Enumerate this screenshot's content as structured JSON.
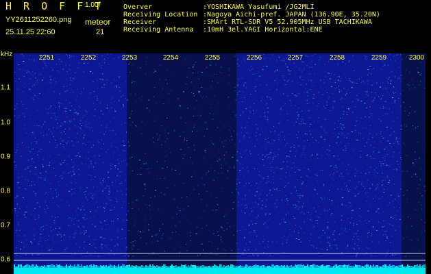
{
  "app": {
    "title": "H R O F F T",
    "version": "1.00f",
    "file_name": "YY2611252260.png",
    "datetime": "25.11.25 22:60",
    "meteor_label": "meteor",
    "meteor_count": "21"
  },
  "info": {
    "rows": [
      {
        "key": "Overver",
        "value": ":YOSHIKAWA Yasufumi /JG2MLI"
      },
      {
        "key": "Receiving Location",
        "value": ":Nagoya Aichi-pref. JAPAN (136.90E, 35.20N)"
      },
      {
        "key": "Receiver",
        "value": ":SMArt RTL-SDR V5 52.905MHz USB TACHIKAWA"
      },
      {
        "key": "Receiving Antenna",
        "value": ":10mH 3el.YAGI Horizontal:ENE"
      }
    ]
  },
  "axis": {
    "unit": "kHz",
    "y_ticks": [
      "1.1",
      "1.0",
      "0.9",
      "0.8",
      "0.7",
      "0.6"
    ]
  },
  "time_axis": {
    "labels": [
      "2251",
      "2252",
      "2253",
      "2254",
      "2255",
      "2256",
      "2257",
      "2258",
      "2259",
      "2300"
    ]
  },
  "spectrogram": {
    "colors": {
      "background": "#0d1792",
      "dark_background": "#08104e",
      "noise": "#3dd7ff",
      "noise_dim": "#2c64ff",
      "baseline": "#00ffff",
      "marker": "#ffffff"
    }
  }
}
